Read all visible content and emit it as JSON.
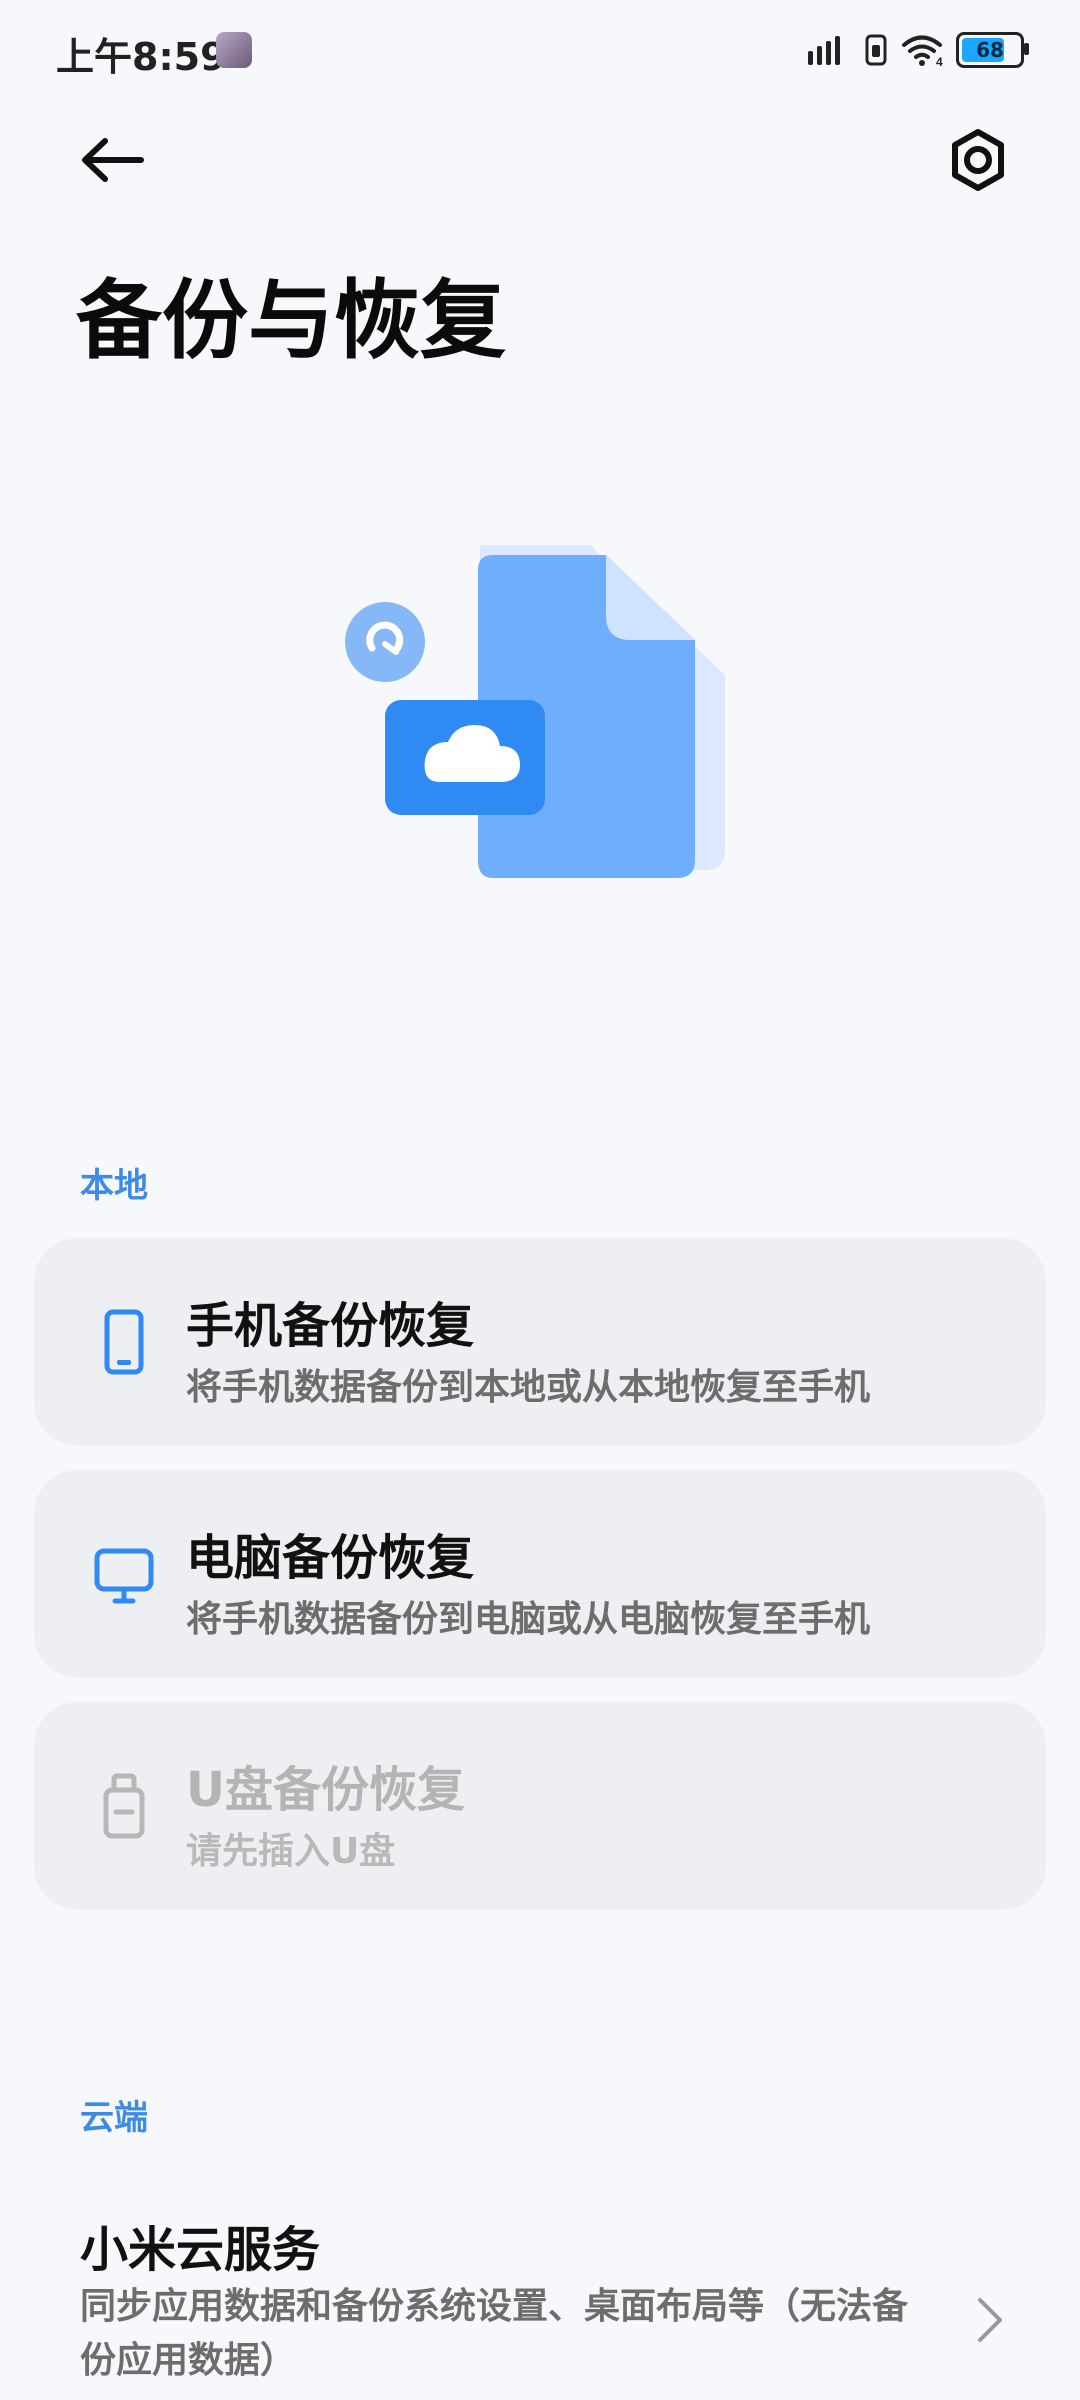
{
  "status_bar": {
    "time": "上午8:59",
    "battery_level": "68"
  },
  "header": {
    "title": "备份与恢复"
  },
  "sections": {
    "local": {
      "label": "本地",
      "items": [
        {
          "title": "手机备份恢复",
          "subtitle": "将手机数据备份到本地或从本地恢复至手机",
          "icon": "phone-icon"
        },
        {
          "title": "电脑备份恢复",
          "subtitle": "将手机数据备份到电脑或从电脑恢复至手机",
          "icon": "computer-icon"
        },
        {
          "title": "U盘备份恢复",
          "subtitle": "请先插入U盘",
          "icon": "usb-drive-icon",
          "disabled": true
        }
      ]
    },
    "cloud": {
      "label": "云端",
      "item": {
        "title": "小米云服务",
        "subtitle": "同步应用数据和备份系统设置、桌面布局等（无法备份应用数据）"
      }
    }
  },
  "colors": {
    "accent": "#3d8be6",
    "background": "#f7f8fb",
    "card": "#eeeff2"
  }
}
